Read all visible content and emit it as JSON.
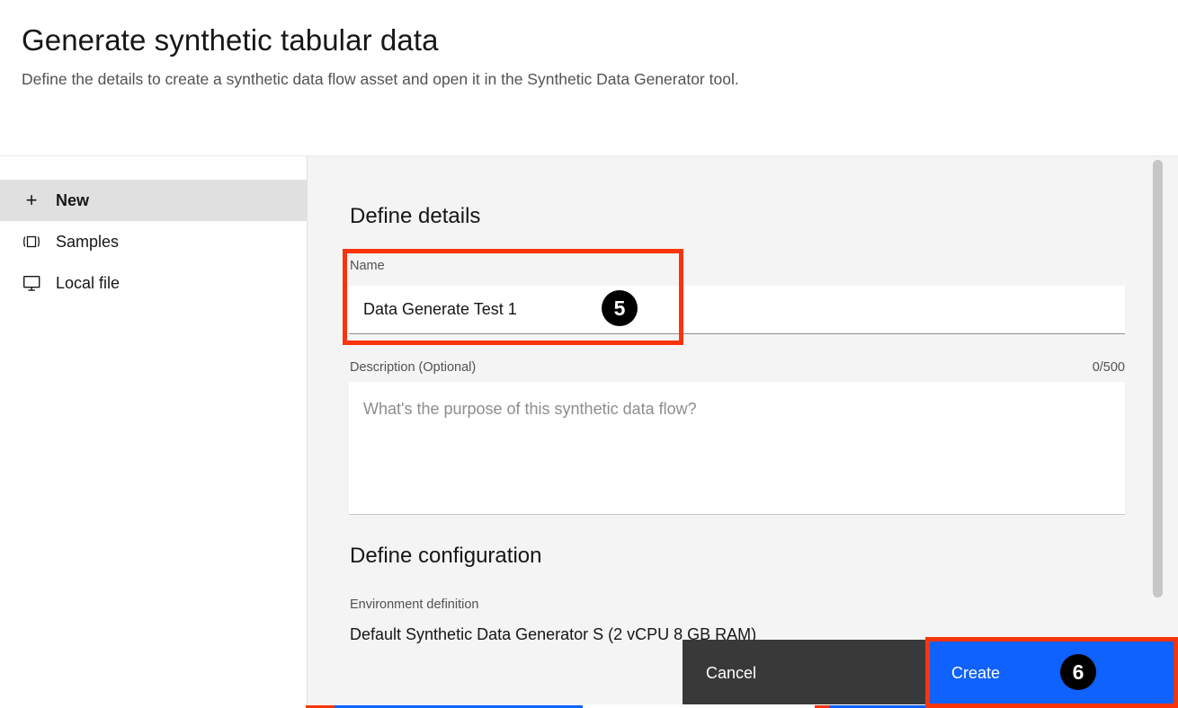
{
  "header": {
    "title": "Generate synthetic tabular data",
    "subtitle": "Define the details to create a synthetic data flow asset and open it in the Synthetic Data Generator tool."
  },
  "sidebar": {
    "items": [
      {
        "label": "New",
        "icon": "plus-icon",
        "selected": true
      },
      {
        "label": "Samples",
        "icon": "samples-icon",
        "selected": false
      },
      {
        "label": "Local file",
        "icon": "monitor-icon",
        "selected": false
      }
    ]
  },
  "main": {
    "details_section": {
      "title": "Define details",
      "name_field": {
        "label": "Name",
        "value": "Data Generate Test 1",
        "placeholder": ""
      },
      "description_field": {
        "label": "Description (Optional)",
        "counter": "0/500",
        "value": "",
        "placeholder": "What's the purpose of this synthetic data flow?"
      }
    },
    "configuration_section": {
      "title": "Define configuration",
      "environment_label": "Environment definition",
      "environment_value": "Default Synthetic Data Generator S (2 vCPU 8 GB RAM)"
    }
  },
  "actions": {
    "cancel_label": "Cancel",
    "create_label": "Create"
  },
  "annotations": {
    "badges": [
      {
        "number": "5",
        "target": "name-input"
      },
      {
        "number": "6",
        "target": "create-button"
      }
    ],
    "highlight_color": "#f9340c",
    "badge_color": "#000000"
  },
  "colors": {
    "accent_blue": "#0f62fe",
    "cancel_gray": "#393939",
    "panel_bg": "#f4f4f4",
    "selected_item": "#e0e0e0"
  }
}
